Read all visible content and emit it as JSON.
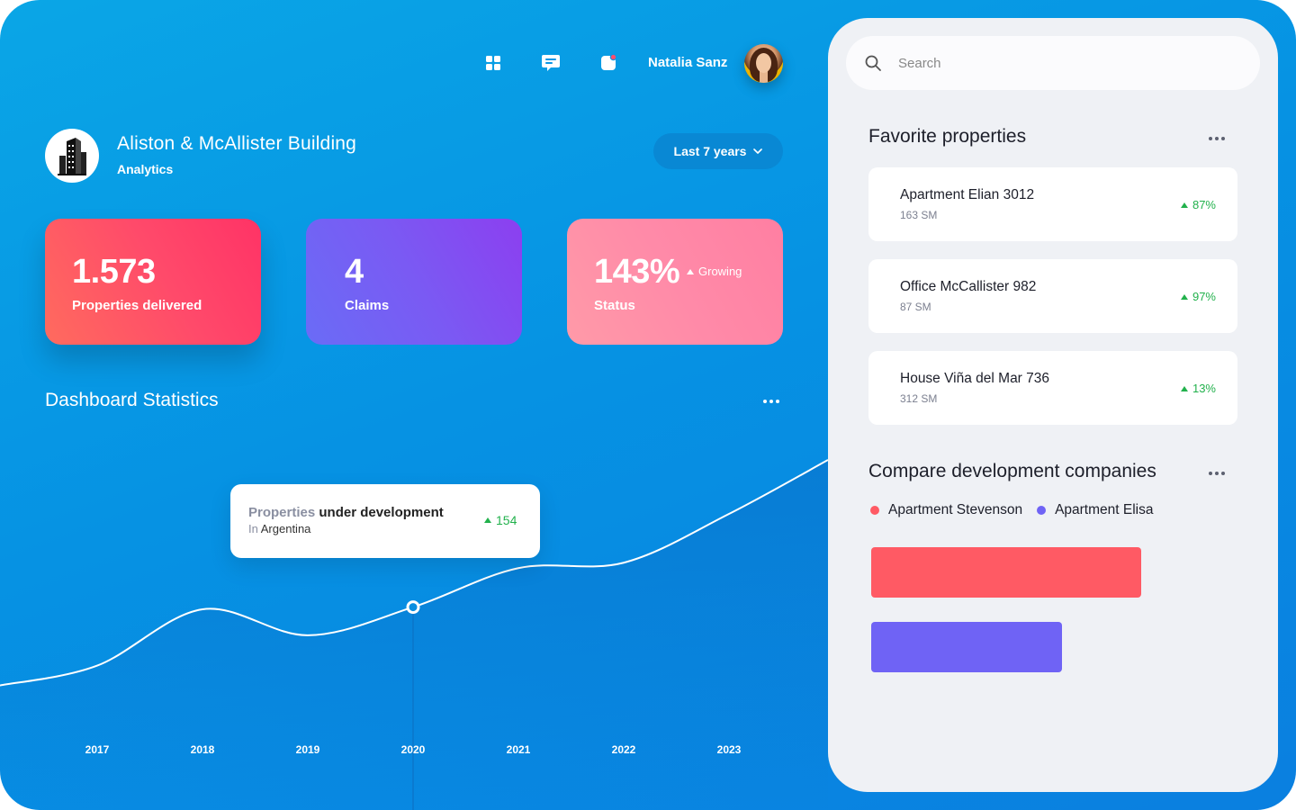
{
  "header": {
    "user_name": "Natalia Sanz",
    "icons": [
      "grid-icon",
      "chat-icon",
      "notification-icon"
    ]
  },
  "building": {
    "title": "Aliston & McAllister Building",
    "subtitle": "Analytics",
    "range_label": "Last 7 years"
  },
  "stats": [
    {
      "value": "1.573",
      "label": "Properties delivered"
    },
    {
      "value": "4",
      "label": "Claims"
    },
    {
      "value": "143%",
      "label": "Status",
      "trend": "Growing"
    }
  ],
  "dashboard": {
    "title": "Dashboard Statistics",
    "tooltip": {
      "title_muted": "Properties",
      "title_main": "under development",
      "sub_muted": "In",
      "sub_main": "Argentina",
      "value": "154"
    }
  },
  "search": {
    "placeholder": "Search"
  },
  "favorites": {
    "title": "Favorite properties",
    "items": [
      {
        "name": "Apartment Elian 3012",
        "size": "163 SM",
        "trend": "87%"
      },
      {
        "name": "Office McCallister 982",
        "size": "87 SM",
        "trend": "97%"
      },
      {
        "name": "House Viña del Mar 736",
        "size": "312 SM",
        "trend": "13%"
      }
    ]
  },
  "compare": {
    "title": "Compare development companies",
    "legend": [
      "Apartment Stevenson",
      "Apartment Elisa"
    ]
  },
  "colors": {
    "accent_green": "#22b14c",
    "series_red": "#ff5a64",
    "series_purple": "#6f63f5"
  },
  "chart_data": [
    {
      "type": "line",
      "title": "Dashboard Statistics",
      "x": [
        "2017",
        "2018",
        "2019",
        "2020",
        "2021",
        "2022",
        "2023"
      ],
      "ylim": [
        0,
        300
      ],
      "grid": false,
      "series": [
        {
          "values": [
            100,
            152,
            128,
            154,
            190,
            195,
            240
          ]
        }
      ],
      "highlight": {
        "x": "2020",
        "value": 154
      }
    },
    {
      "type": "bar",
      "title": "Compare development companies",
      "categories": [
        "Apartment Stevenson",
        "Apartment Elisa"
      ],
      "values": [
        300,
        212
      ],
      "xlim": [
        0,
        300
      ],
      "orientation": "horizontal",
      "grid": false
    }
  ]
}
